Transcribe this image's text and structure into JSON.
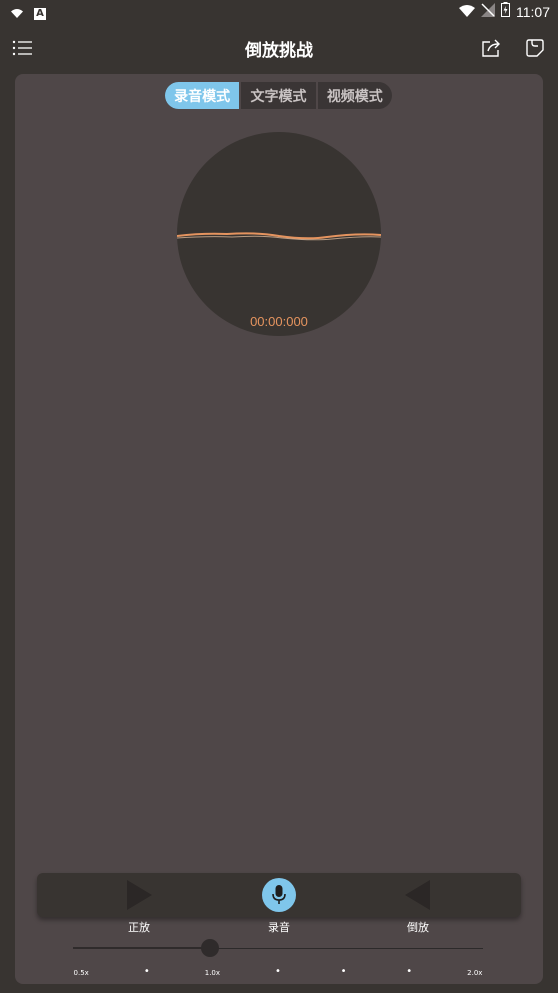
{
  "status_bar": {
    "time": "11:07",
    "a_badge": "A"
  },
  "app_bar": {
    "title": "倒放挑战",
    "menu_icon": "menu-list-icon",
    "share_icon": "share-icon",
    "note_icon": "note-icon"
  },
  "mode_tabs": [
    {
      "label": "录音模式",
      "active": true
    },
    {
      "label": "文字模式",
      "active": false
    },
    {
      "label": "视频模式",
      "active": false
    }
  ],
  "recorder": {
    "timer": "00:00:000",
    "wave_color": "#e5945f"
  },
  "controls": {
    "play_label": "正放",
    "record_label": "录音",
    "reverse_label": "倒放"
  },
  "speed": {
    "value": 1.0,
    "min": 0.5,
    "max": 2.0,
    "ticks": [
      "0.5x",
      "•",
      "1.0x",
      "•",
      "•",
      "•",
      "2.0x"
    ]
  },
  "colors": {
    "accent": "#7fc6eb",
    "panel": "#4f4748",
    "background": "#383431",
    "timer": "#e5945f"
  }
}
